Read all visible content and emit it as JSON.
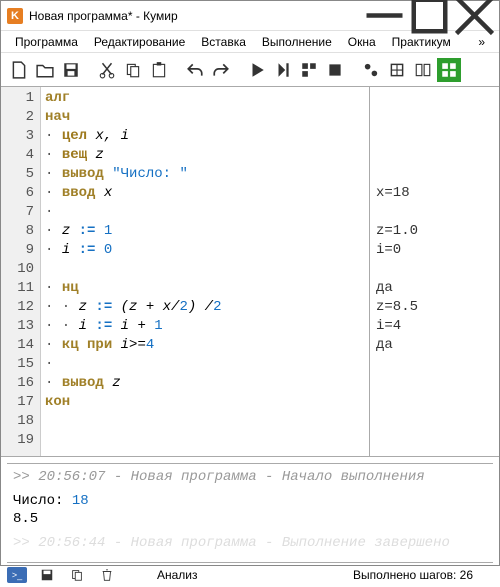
{
  "window": {
    "icon_letter": "K",
    "title": "Новая программа* - Кумир"
  },
  "menu": {
    "program": "Программа",
    "edit": "Редактирование",
    "insert": "Вставка",
    "run": "Выполнение",
    "windows": "Окна",
    "practice": "Практикум",
    "more": "»"
  },
  "code": {
    "lines": [
      "1",
      "2",
      "3",
      "4",
      "5",
      "6",
      "7",
      "8",
      "9",
      "10",
      "11",
      "12",
      "13",
      "14",
      "15",
      "16",
      "17",
      "18",
      "19"
    ],
    "l1_kw": "алг",
    "l2_kw": "нач",
    "l3_ty": "цел",
    "l3_rest": " x, i",
    "l4_ty": "вещ",
    "l4_rest": " z",
    "l5_kw": "вывод",
    "l5_str": "\"Число: \"",
    "l6_kw": "ввод",
    "l6_var": " x",
    "l8_a": "z ",
    "l8_op": ":=",
    "l8_b": " ",
    "l8_n": "1",
    "l9_a": "i ",
    "l9_op": ":=",
    "l9_b": " ",
    "l9_n": "0",
    "l11_kw": "нц",
    "l12_a": "z ",
    "l12_op": ":=",
    "l12_b": " (z + x/",
    "l12_n1": "2",
    "l12_c": ") /",
    "l12_n2": "2",
    "l13_a": "i ",
    "l13_op": ":=",
    "l13_b": " i + ",
    "l13_n": "1",
    "l14_kw": "кц при",
    "l14_cond": " i>=",
    "l14_n": "4",
    "l16_kw": "вывод",
    "l16_var": " z",
    "l17_kw": "кон"
  },
  "trace": {
    "t6": "x=18",
    "t8": "z=1.0",
    "t9": "i=0",
    "t11": "да",
    "t12": "z=8.5",
    "t13": "i=4",
    "t14": "да"
  },
  "output": {
    "ts": ">> 20:56:07 - Новая программа - Начало выполнения",
    "prompt": "Число: ",
    "input": "18",
    "result": "8.5",
    "faint": ">> 20:56:44 - Новая программа - Выполнение завершено"
  },
  "status": {
    "analysis": "Анализ",
    "steps": "Выполнено шагов: 26"
  }
}
